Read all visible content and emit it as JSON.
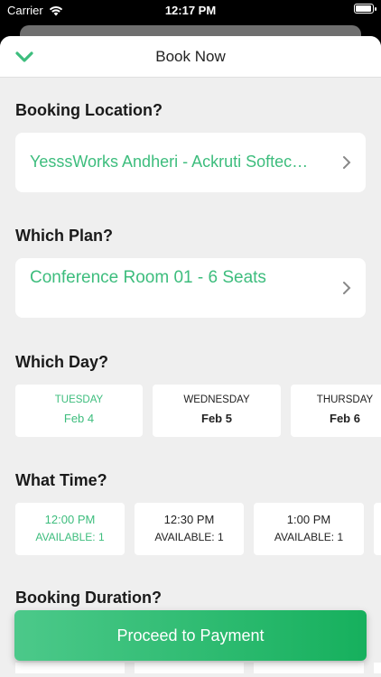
{
  "status_bar": {
    "carrier": "Carrier",
    "time": "12:17 PM"
  },
  "header": {
    "title": "Book Now"
  },
  "sections": {
    "location": {
      "title": "Booking Location?",
      "value": "YesssWorks  Andheri - Ackruti Softec…"
    },
    "plan": {
      "title": "Which Plan?",
      "value": "Conference Room 01 - 6 Seats"
    },
    "day": {
      "title": "Which Day?",
      "items": [
        {
          "weekday": "TUESDAY",
          "date": "Feb 4"
        },
        {
          "weekday": "WEDNESDAY",
          "date": "Feb 5"
        },
        {
          "weekday": "THURSDAY",
          "date": "Feb 6"
        }
      ]
    },
    "time": {
      "title": "What Time?",
      "items": [
        {
          "time": "12:00 PM",
          "availability": "AVAILABLE: 1"
        },
        {
          "time": "12:30 PM",
          "availability": "AVAILABLE: 1"
        },
        {
          "time": "1:00 PM",
          "availability": "AVAILABLE: 1"
        }
      ]
    },
    "duration": {
      "title": "Booking Duration?"
    }
  },
  "cta": {
    "label": "Proceed to Payment"
  },
  "colors": {
    "accent": "#3dbd7d",
    "cta_start": "#4cc98a",
    "cta_end": "#16b05d"
  }
}
